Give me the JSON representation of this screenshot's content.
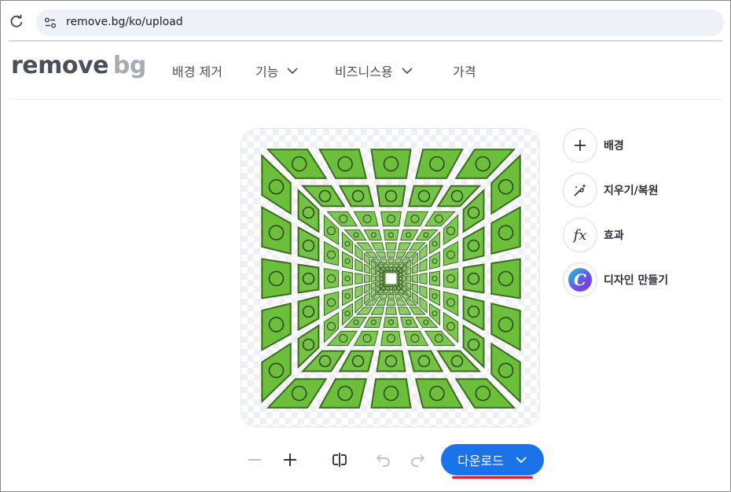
{
  "browser": {
    "url": "remove.bg/ko/upload",
    "icons": [
      "reload-icon",
      "site-info-icon"
    ]
  },
  "site": {
    "logo_part1": "remove",
    "logo_part2": "bg",
    "nav": [
      {
        "label": "배경 제거",
        "has_dropdown": false
      },
      {
        "label": "기능",
        "has_dropdown": true
      },
      {
        "label": "비즈니스용",
        "has_dropdown": true
      },
      {
        "label": "가격",
        "has_dropdown": false
      }
    ]
  },
  "tools": [
    {
      "label": "배경",
      "icon": "plus-icon"
    },
    {
      "label": "지우기/복원",
      "icon": "magic-brush-icon"
    },
    {
      "label": "효과",
      "icon": "fx-icon",
      "glyph": "fx"
    },
    {
      "label": "디자인 만들기",
      "icon": "canva-icon",
      "glyph": "C"
    }
  ],
  "toolbar": {
    "download_label": "다운로드",
    "icons": [
      "zoom-out-icon",
      "zoom-in-icon",
      "compare-icon",
      "undo-icon",
      "redo-icon",
      "chevron-down-icon"
    ]
  },
  "colors": {
    "accent": "#1a73e8",
    "tile_green": "#6bbf3a",
    "underline_red": "#e2161f"
  }
}
